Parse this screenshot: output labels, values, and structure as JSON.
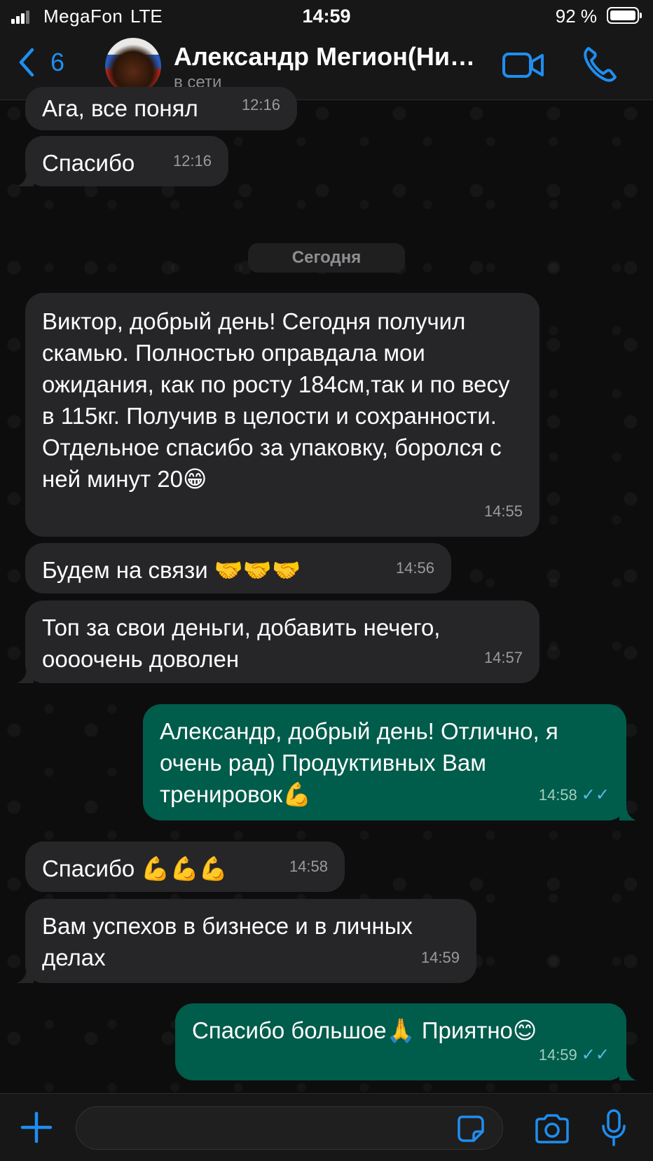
{
  "status_bar": {
    "carrier": "MegaFon",
    "network": "LTE",
    "time": "14:59",
    "battery": "92 %"
  },
  "header": {
    "back_count": "6",
    "contact_name": "Александр Мегион(Ни…",
    "contact_status": "в сети"
  },
  "chat": {
    "date_separator": "Сегодня",
    "messages": [
      {
        "dir": "in",
        "text": "Ага, все понял",
        "time": "12:16"
      },
      {
        "dir": "in",
        "text": "Спасибо",
        "time": "12:16"
      },
      {
        "dir": "in",
        "text": "Виктор, добрый день! Сегодня получил скамью. Полностью оправдала мои ожидания, как по росту 184см,так и по весу в 115кг. Получив в целости и сохранности. Отдельное спасибо за упаковку, боролся с ней минут 20😁",
        "time": "14:55"
      },
      {
        "dir": "in",
        "text": "Будем на связи 🤝🤝🤝",
        "time": "14:56"
      },
      {
        "dir": "in",
        "text": "Топ за свои деньги, добавить нечего, оооочень доволен",
        "time": "14:57"
      },
      {
        "dir": "out",
        "text": "Александр, добрый день! Отлично, я очень рад) Продуктивных Вам тренировок💪",
        "time": "14:58",
        "ticks": "✓✓"
      },
      {
        "dir": "in",
        "text": "Спасибо 💪💪💪",
        "time": "14:58"
      },
      {
        "dir": "in",
        "text": "Вам успехов в бизнесе и в личных делах",
        "time": "14:59"
      },
      {
        "dir": "out",
        "text": "Спасибо большое🙏 Приятно😊",
        "time": "14:59",
        "ticks": "✓✓"
      }
    ]
  },
  "composer": {
    "placeholder": ""
  },
  "colors": {
    "accent": "#1f8ef1",
    "incoming_bubble": "#262628",
    "outgoing_bubble": "#005c4b",
    "read_ticks": "#53bdeb"
  },
  "icons": [
    "signal-icon",
    "battery-icon",
    "back-chevron-icon",
    "video-call-icon",
    "phone-icon",
    "plus-icon",
    "sticker-icon",
    "camera-icon",
    "microphone-icon"
  ]
}
